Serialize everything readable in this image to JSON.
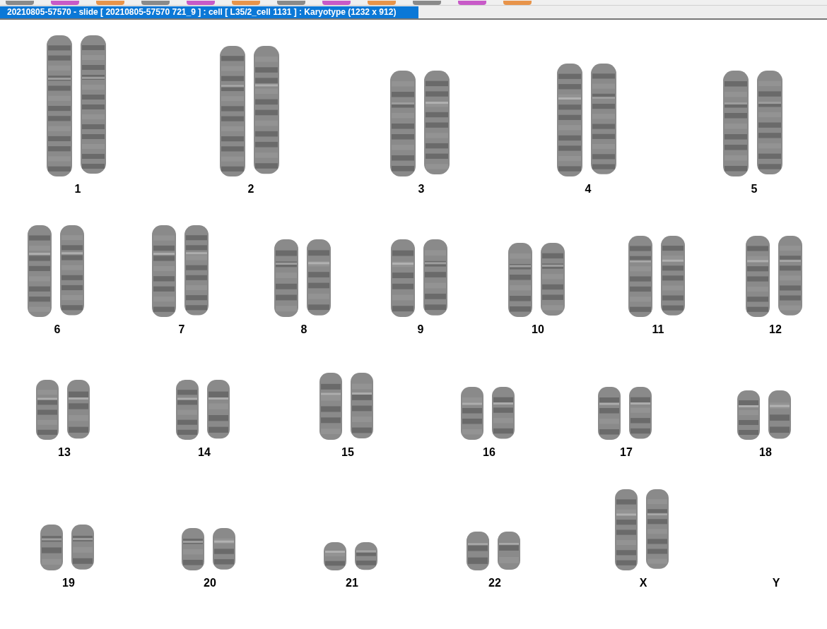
{
  "window": {
    "title": "20210805-57570 - slide [ 20210805-57570 721_9 ] : cell [ L35/2_cell 1131 ] : Karyotype  (1232 x 912)"
  },
  "karyotype": {
    "rows": [
      {
        "pairs": [
          {
            "label": "1",
            "present": true
          },
          {
            "label": "2",
            "present": true
          },
          {
            "label": "3",
            "present": true
          },
          {
            "label": "4",
            "present": true
          },
          {
            "label": "5",
            "present": true
          }
        ]
      },
      {
        "pairs": [
          {
            "label": "6",
            "present": true
          },
          {
            "label": "7",
            "present": true
          },
          {
            "label": "8",
            "present": true
          },
          {
            "label": "9",
            "present": true
          },
          {
            "label": "10",
            "present": true
          },
          {
            "label": "11",
            "present": true
          },
          {
            "label": "12",
            "present": true
          }
        ]
      },
      {
        "pairs": [
          {
            "label": "13",
            "present": true
          },
          {
            "label": "14",
            "present": true
          },
          {
            "label": "15",
            "present": true
          },
          {
            "label": "16",
            "present": true
          },
          {
            "label": "17",
            "present": true
          },
          {
            "label": "18",
            "present": true
          }
        ]
      },
      {
        "pairs": [
          {
            "label": "19",
            "present": true
          },
          {
            "label": "20",
            "present": true
          },
          {
            "label": "21",
            "present": true
          },
          {
            "label": "22",
            "present": true
          },
          {
            "label": "X",
            "present": true
          },
          {
            "label": "Y",
            "present": false
          }
        ]
      }
    ]
  }
}
